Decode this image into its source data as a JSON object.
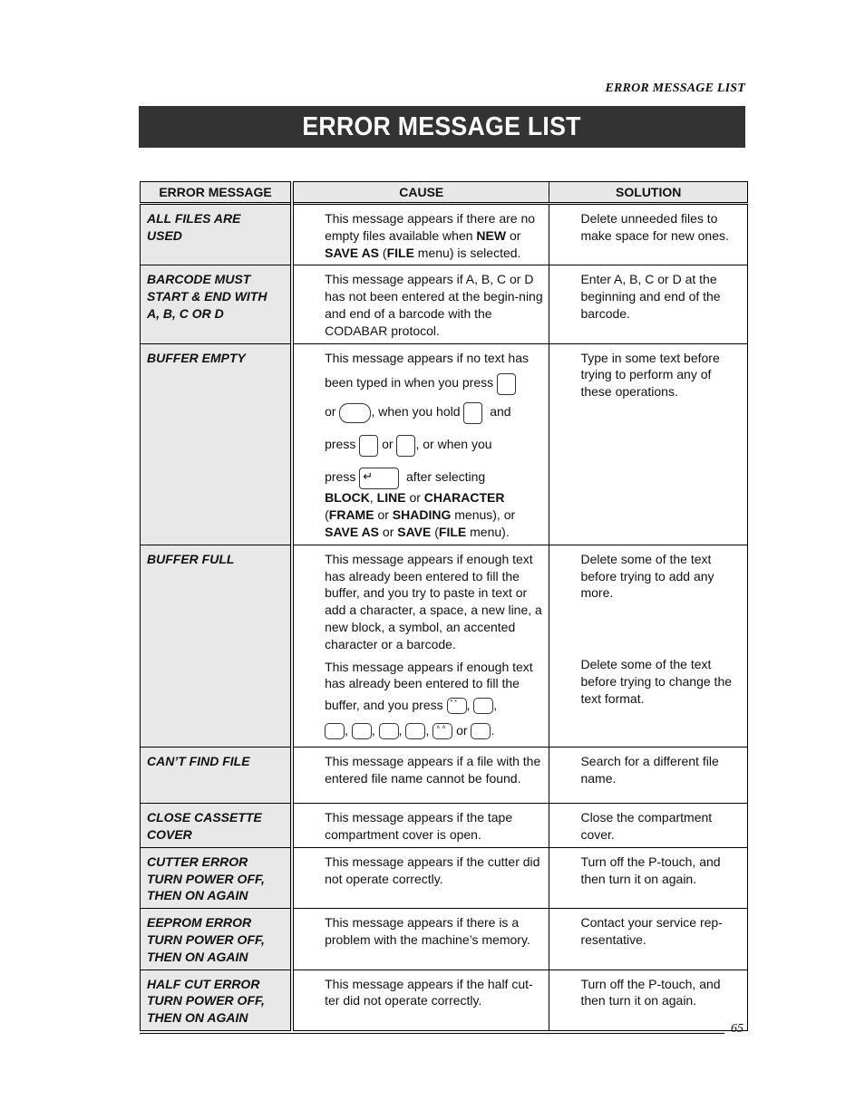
{
  "running_head": "ERROR MESSAGE LIST",
  "title": "ERROR MESSAGE LIST",
  "table": {
    "headers": [
      "ERROR MESSAGE",
      "CAUSE",
      "SOLUTION"
    ],
    "rows": [
      {
        "error": [
          "ALL FILES ARE",
          "USED"
        ],
        "cause_parts": [
          "This message appears if there are no empty files available when ",
          "NEW",
          " or ",
          "SAVE AS",
          " (",
          "FILE",
          " menu) is selected."
        ],
        "solution": "Delete unneeded files to make space for new ones."
      },
      {
        "error": [
          "BARCODE MUST",
          "START & END WITH",
          "A, B, C OR D"
        ],
        "cause": "This message appears if A, B, C or D has not been entered at the begin-ning and end of a barcode with the CODABAR protocol.",
        "solution": "Enter A, B, C or D at the beginning and end of the barcode."
      },
      {
        "error": [
          "BUFFER EMPTY"
        ],
        "cause_lines": {
          "l1": "This message appears if no text has",
          "l2": "been typed in when you press",
          "l3a": "or",
          "l3b": ", when you hold",
          "l3c": "and",
          "l4a": "press",
          "l4b": "or",
          "l4c": ", or when you",
          "l5a": "press",
          "l5b": "after selecting",
          "enter_glyph": "↵",
          "tail": [
            "BLOCK",
            ", ",
            "LINE",
            " or ",
            "CHARACTER",
            "(",
            "FRAME",
            " or ",
            "SHADING",
            " menus), or",
            "SAVE AS",
            " or ",
            "SAVE",
            " (",
            "FILE",
            " menu)."
          ]
        },
        "solution": "Type in some text before trying to perform any of these operations."
      },
      {
        "error": [
          "BUFFER FULL"
        ],
        "cause": "This message appears if enough text has already been entered to fill the buffer, and you try to paste in text or add a character, a space, a new line, a new block, a symbol, an accented character or a barcode.",
        "solution": "Delete some of the text before trying to add any more.",
        "cause2_text": "This message appears if enough text has already been entered to fill the",
        "cause2_line3": "buffer, and you press",
        "cause2_or": "or",
        "solution2": "Delete some of the text before trying to change the text format."
      },
      {
        "error": [
          "CAN’T FIND FILE"
        ],
        "cause": "This message appears if a file with the entered file name cannot be found.",
        "solution": "Search for a different file name."
      },
      {
        "error": [
          "CLOSE CASSETTE",
          "COVER"
        ],
        "cause": "This message appears if the tape compartment cover is open.",
        "solution": "Close the compartment cover."
      },
      {
        "error": [
          "CUTTER ERROR",
          "TURN POWER OFF,",
          "THEN ON AGAIN"
        ],
        "cause": "This message appears if the cutter did not operate correctly.",
        "solution": "Turn off the P-touch, and then turn it on again."
      },
      {
        "error": [
          "EEPROM ERROR",
          "TURN POWER OFF,",
          "THEN ON AGAIN"
        ],
        "cause": "This message appears if there is a problem with the machine’s memory.",
        "solution": "Contact your service rep-resentative."
      },
      {
        "error": [
          "HALF CUT ERROR",
          "TURN POWER OFF,",
          "THEN ON AGAIN"
        ],
        "cause": "This message appears if the half cut-ter did not operate correctly.",
        "solution": "Turn off the P-touch, and then turn it on again."
      }
    ]
  },
  "page_number": "65"
}
